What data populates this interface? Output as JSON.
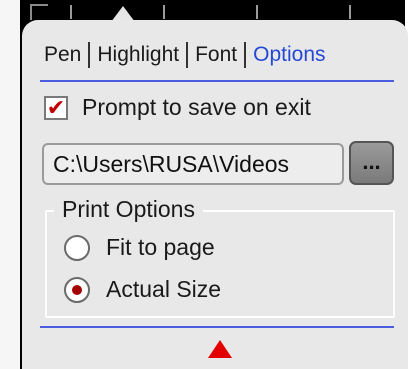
{
  "tabs": [
    {
      "label": "Pen",
      "active": false
    },
    {
      "label": "Highlight",
      "active": false
    },
    {
      "label": "Font",
      "active": false
    },
    {
      "label": "Options",
      "active": true
    }
  ],
  "prompt_save": {
    "label": "Prompt to save on exit",
    "checked": true
  },
  "save_path": {
    "value": "C:\\Users\\RUSA\\Videos"
  },
  "browse_button": {
    "label": "..."
  },
  "print_options": {
    "title": "Print Options",
    "choices": [
      {
        "label": "Fit to page",
        "selected": false
      },
      {
        "label": "Actual Size",
        "selected": true
      }
    ]
  },
  "colors": {
    "accent": "#2449d6",
    "check": "#c00000",
    "collapse_arrow": "#e40000"
  },
  "icons": {
    "collapse": "triangle-up-icon"
  }
}
